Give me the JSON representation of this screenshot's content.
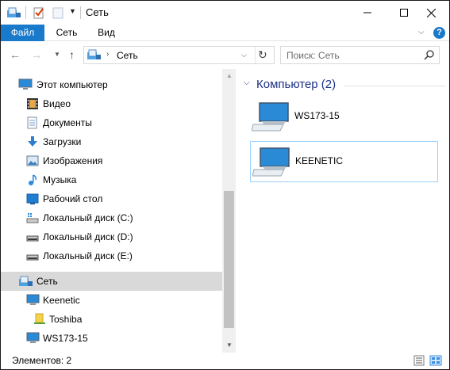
{
  "window": {
    "title": "Сеть"
  },
  "ribbon": {
    "tabs": [
      "Файл",
      "Сеть",
      "Вид"
    ],
    "help": "?"
  },
  "address": {
    "location": "Сеть",
    "search_placeholder": "Поиск: Сеть"
  },
  "navigation": {
    "items": [
      {
        "label": "Этот компьютер",
        "icon": "pc-icon",
        "level": 0
      },
      {
        "label": "Видео",
        "icon": "video-folder-icon",
        "level": 1
      },
      {
        "label": "Документы",
        "icon": "documents-folder-icon",
        "level": 1
      },
      {
        "label": "Загрузки",
        "icon": "downloads-folder-icon",
        "level": 1
      },
      {
        "label": "Изображения",
        "icon": "pictures-folder-icon",
        "level": 1
      },
      {
        "label": "Музыка",
        "icon": "music-folder-icon",
        "level": 1
      },
      {
        "label": "Рабочий стол",
        "icon": "desktop-folder-icon",
        "level": 1
      },
      {
        "label": "Локальный диск (C:)",
        "icon": "system-drive-icon",
        "level": 1
      },
      {
        "label": "Локальный диск (D:)",
        "icon": "drive-icon",
        "level": 1
      },
      {
        "label": "Локальный диск (E:)",
        "icon": "drive-icon",
        "level": 1
      },
      {
        "label": "Сеть",
        "icon": "network-icon",
        "level": 0,
        "selected": true
      },
      {
        "label": "Keenetic",
        "icon": "computer-icon",
        "level": 1
      },
      {
        "label": "Toshiba",
        "icon": "shared-folder-icon",
        "level": 2
      },
      {
        "label": "WS173-15",
        "icon": "computer-icon",
        "level": 1
      }
    ]
  },
  "content": {
    "group_title": "Компьютер (2)",
    "computers": [
      {
        "name": "WS173-15",
        "selected": false
      },
      {
        "name": "KEENETIC",
        "selected": true
      }
    ]
  },
  "status": {
    "text": "Элементов: 2"
  },
  "colors": {
    "accent": "#1979ca",
    "group_title": "#1e3287",
    "selection": "#d9d9d9",
    "tile_border": "#99d1ff"
  }
}
